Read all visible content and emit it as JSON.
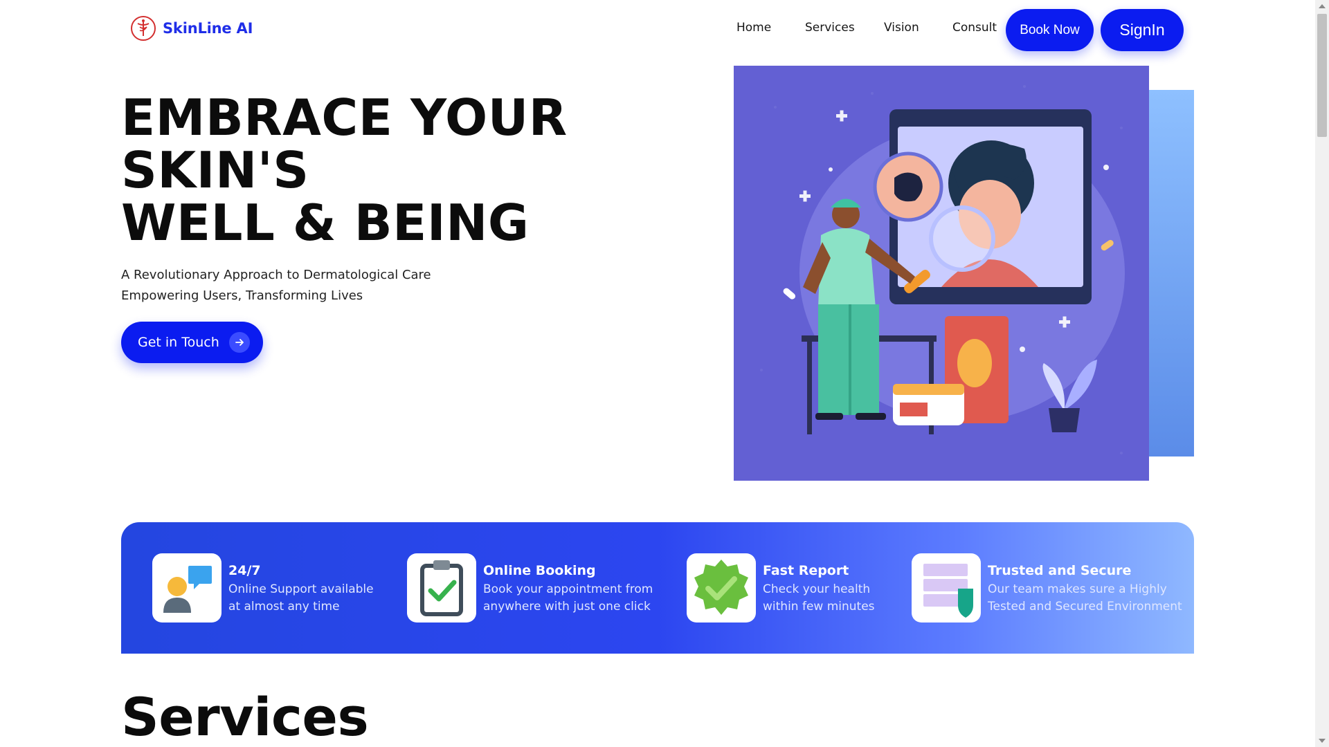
{
  "header": {
    "brand": "SkinLine AI",
    "nav": [
      "Home",
      "Services",
      "Vision",
      "Consult"
    ],
    "book_label": "Book Now",
    "signin_label": "SignIn"
  },
  "hero": {
    "title_line1": "EMBRACE YOUR",
    "title_line2": "SKIN'S",
    "title_line3": "WELL & BEING",
    "subtitle_line1": "A Revolutionary Approach to Dermatological Care",
    "subtitle_line2": "Empowering Users, Transforming Lives",
    "cta_label": "Get in Touch"
  },
  "features": [
    {
      "title": "24/7",
      "desc1": "Online Support available",
      "desc2": "at almost any time",
      "icon": "support-chat-icon"
    },
    {
      "title": "Online Booking",
      "desc1": "Book your appointment from",
      "desc2": "anywhere with just one click",
      "icon": "clipboard-check-icon"
    },
    {
      "title": "Fast Report",
      "desc1": "Check your health",
      "desc2": "within few minutes",
      "icon": "badge-check-icon"
    },
    {
      "title": "Trusted and Secure",
      "desc1": "Our team makes sure a Highly",
      "desc2": "Tested and Secured Environment",
      "icon": "shield-list-icon"
    }
  ],
  "services": {
    "title": "Services"
  },
  "colors": {
    "primary": "#0b1cf0",
    "illustration_bg": "#6360d3",
    "band_start": "#2446e0",
    "band_end": "#8fb8ff"
  }
}
